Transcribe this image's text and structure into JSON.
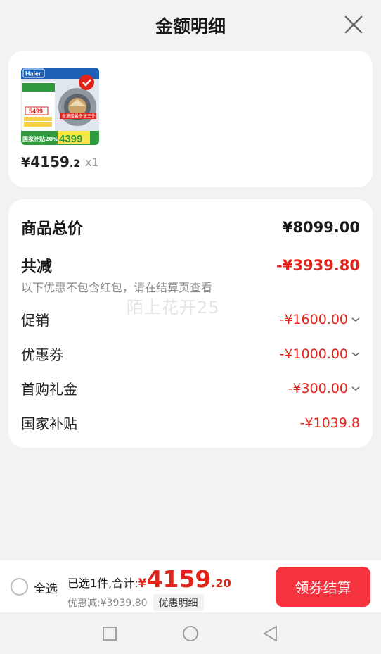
{
  "header": {
    "title": "金额明细"
  },
  "product": {
    "price_yen": "¥",
    "price_int": "4159",
    "price_dec": ".2",
    "quantity": "x1",
    "thumb": {
      "brand": "Haier",
      "badge_price": "5499",
      "sale_price": "4399",
      "subsidy_text": "国家补贴20%",
      "gift_text": "盈满赠最多享三件"
    }
  },
  "detail": {
    "total_label": "商品总价",
    "total_value": "¥8099.00",
    "reduce_label": "共减",
    "reduce_value": "-¥3939.80",
    "note": "以下优惠不包含红包，请在结算页查看",
    "watermark": "陌上花开25",
    "items": [
      {
        "label": "促销",
        "value": "-¥1600.00"
      },
      {
        "label": "优惠券",
        "value": "-¥1000.00"
      },
      {
        "label": "首购礼金",
        "value": "-¥300.00"
      },
      {
        "label": "国家补贴",
        "value": "-¥1039.8"
      }
    ]
  },
  "bottom": {
    "select_all": "全选",
    "selected_text": "已选1件,合计:",
    "total_yen": "¥",
    "total_int": "4159",
    "total_dec": ".20",
    "discount_text": "优惠减:¥3939.80",
    "detail_chip": "优惠明细",
    "checkout_button": "领券结算"
  },
  "colors": {
    "accent_red": "#e2231a",
    "button_red": "#f5333f"
  }
}
